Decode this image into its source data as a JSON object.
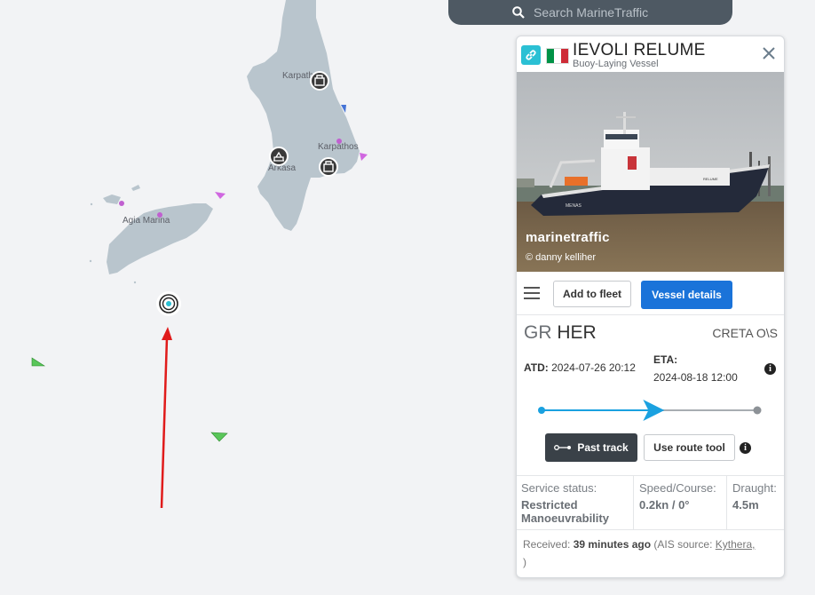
{
  "search": {
    "placeholder": "Search MarineTraffic"
  },
  "map": {
    "labels": {
      "karpathos_north": "Karpathos",
      "karpathos_east": "Karpathos",
      "arkasa": "Arkasa",
      "agia_marina": "Agia Marina"
    },
    "land_color": "#b9c5cd",
    "water_color": "#f2f3f5"
  },
  "vessel": {
    "name": "IEVOLI RELUME",
    "type": "Buoy-Laying Vessel",
    "flag_colors": [
      "#009246",
      "#ffffff",
      "#ce2b37"
    ],
    "photo": {
      "watermark": "marinetraffic",
      "credit": "© danny kelliher"
    },
    "actions": {
      "add_to_fleet": "Add to fleet",
      "vessel_details": "Vessel details"
    },
    "route": {
      "from_country": "GR",
      "from_port": "HER",
      "to": "CRETA O\\S",
      "atd_label": "ATD:",
      "atd_value": "2024-07-26 20:12",
      "eta_label": "ETA:",
      "eta_value": "2024-08-18 12:00",
      "progress": 0.52
    },
    "tools": {
      "past_track": "Past track",
      "route_tool": "Use route tool"
    },
    "status": {
      "service_label": "Service status:",
      "service_value": "Restricted Manoeuvrability",
      "speed_label": "Speed/Course:",
      "speed_value": "0.2kn / 0°",
      "draught_label": "Draught:",
      "draught_value": "4.5m"
    },
    "received": {
      "prefix": "Received: ",
      "time": "39 minutes ago",
      "middle": " (AIS source: ",
      "source": "Kythera,",
      "suffix": ")"
    }
  },
  "colors": {
    "accent_blue": "#1a73d9",
    "track_blue": "#1aa1e0",
    "pointer_red": "#e01b1b",
    "cyan": "#2bc0d4"
  }
}
